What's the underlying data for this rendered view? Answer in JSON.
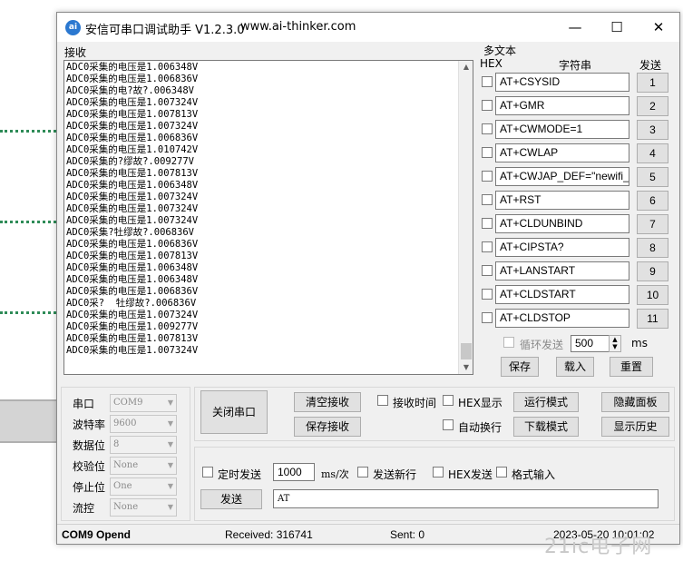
{
  "window": {
    "app_icon": "ai-thinker-logo-icon",
    "title": "安信可串口调试助手 V1.2.3.0",
    "url": "www.ai-thinker.com",
    "minimize": "—",
    "maximize": "☐",
    "close": "✕"
  },
  "receive": {
    "label": "接收",
    "lines": [
      "ADC0采集的电压是1.006348V",
      "ADC0采集的电压是1.006836V",
      "ADC0采集的电?故?.006348V",
      "ADC0采集的电压是1.007324V",
      "ADC0采集的电压是1.007813V",
      "ADC0采集的电压是1.007324V",
      "ADC0采集的电压是1.006836V",
      "ADC0采集的电压是1.010742V",
      "ADC0采集的?缪故?.009277V",
      "ADC0采集的电压是1.007813V",
      "ADC0采集的电压是1.006348V",
      "ADC0采集的电压是1.007324V",
      "ADC0采集的电压是1.007324V",
      "ADC0采集的电压是1.007324V",
      "ADC0采集?牡缪故?.006836V",
      "ADC0采集的电压是1.006836V",
      "ADC0采集的电压是1.007813V",
      "ADC0采集的电压是1.006348V",
      "ADC0采集的电压是1.006348V",
      "ADC0采集的电压是1.006836V",
      "ADC0采?  牡缪故?.006836V",
      "ADC0采集的电压是1.007324V",
      "ADC0采集的电压是1.009277V",
      "ADC0采集的电压是1.007813V",
      "ADC0采集的电压是1.007324V"
    ]
  },
  "multi": {
    "title": "多文本",
    "hex_header": "HEX",
    "str_header": "字符串",
    "send_header": "发送",
    "rows": [
      {
        "text": "AT+CSYSID",
        "num": "1"
      },
      {
        "text": "AT+GMR",
        "num": "2"
      },
      {
        "text": "AT+CWMODE=1",
        "num": "3"
      },
      {
        "text": "AT+CWLAP",
        "num": "4"
      },
      {
        "text": "AT+CWJAP_DEF=\"newifi_",
        "num": "5"
      },
      {
        "text": "AT+RST",
        "num": "6"
      },
      {
        "text": "AT+CLDUNBIND",
        "num": "7"
      },
      {
        "text": "AT+CIPSTA?",
        "num": "8"
      },
      {
        "text": "AT+LANSTART",
        "num": "9"
      },
      {
        "text": "AT+CLDSTART",
        "num": "10"
      },
      {
        "text": "AT+CLDSTOP",
        "num": "11"
      }
    ],
    "loop_label": "循环发送",
    "loop_ms": "500",
    "ms_unit": "ms",
    "save": "保存",
    "load": "载入",
    "reset": "重置"
  },
  "serial": {
    "port_label": "串口",
    "port_value": "COM9",
    "baud_label": "波特率",
    "baud_value": "9600",
    "data_label": "数据位",
    "data_value": "8",
    "parity_label": "校验位",
    "parity_value": "None",
    "stop_label": "停止位",
    "stop_value": "One",
    "flow_label": "流控",
    "flow_value": "None"
  },
  "controls": {
    "close_port": "关闭串口",
    "clear_recv": "清空接收",
    "save_recv": "保存接收",
    "recv_time": "接收时间",
    "hex_display": "HEX显示",
    "auto_wrap": "自动换行",
    "run_mode": "运行模式",
    "download_mode": "下载模式",
    "hide_panel": "隐藏面板",
    "show_history": "显示历史"
  },
  "send": {
    "timed_send": "定时发送",
    "interval": "1000",
    "interval_unit": "ms/次",
    "send_newline": "发送新行",
    "hex_send": "HEX发送",
    "format_input": "格式输入",
    "send_button": "发送",
    "send_text": "AT"
  },
  "status": {
    "port_state": "COM9 Opend",
    "received": "Received: 316741",
    "sent": "Sent: 0",
    "datetime": "2023-05-20 10:01:02"
  },
  "watermark": "21ic电子网"
}
